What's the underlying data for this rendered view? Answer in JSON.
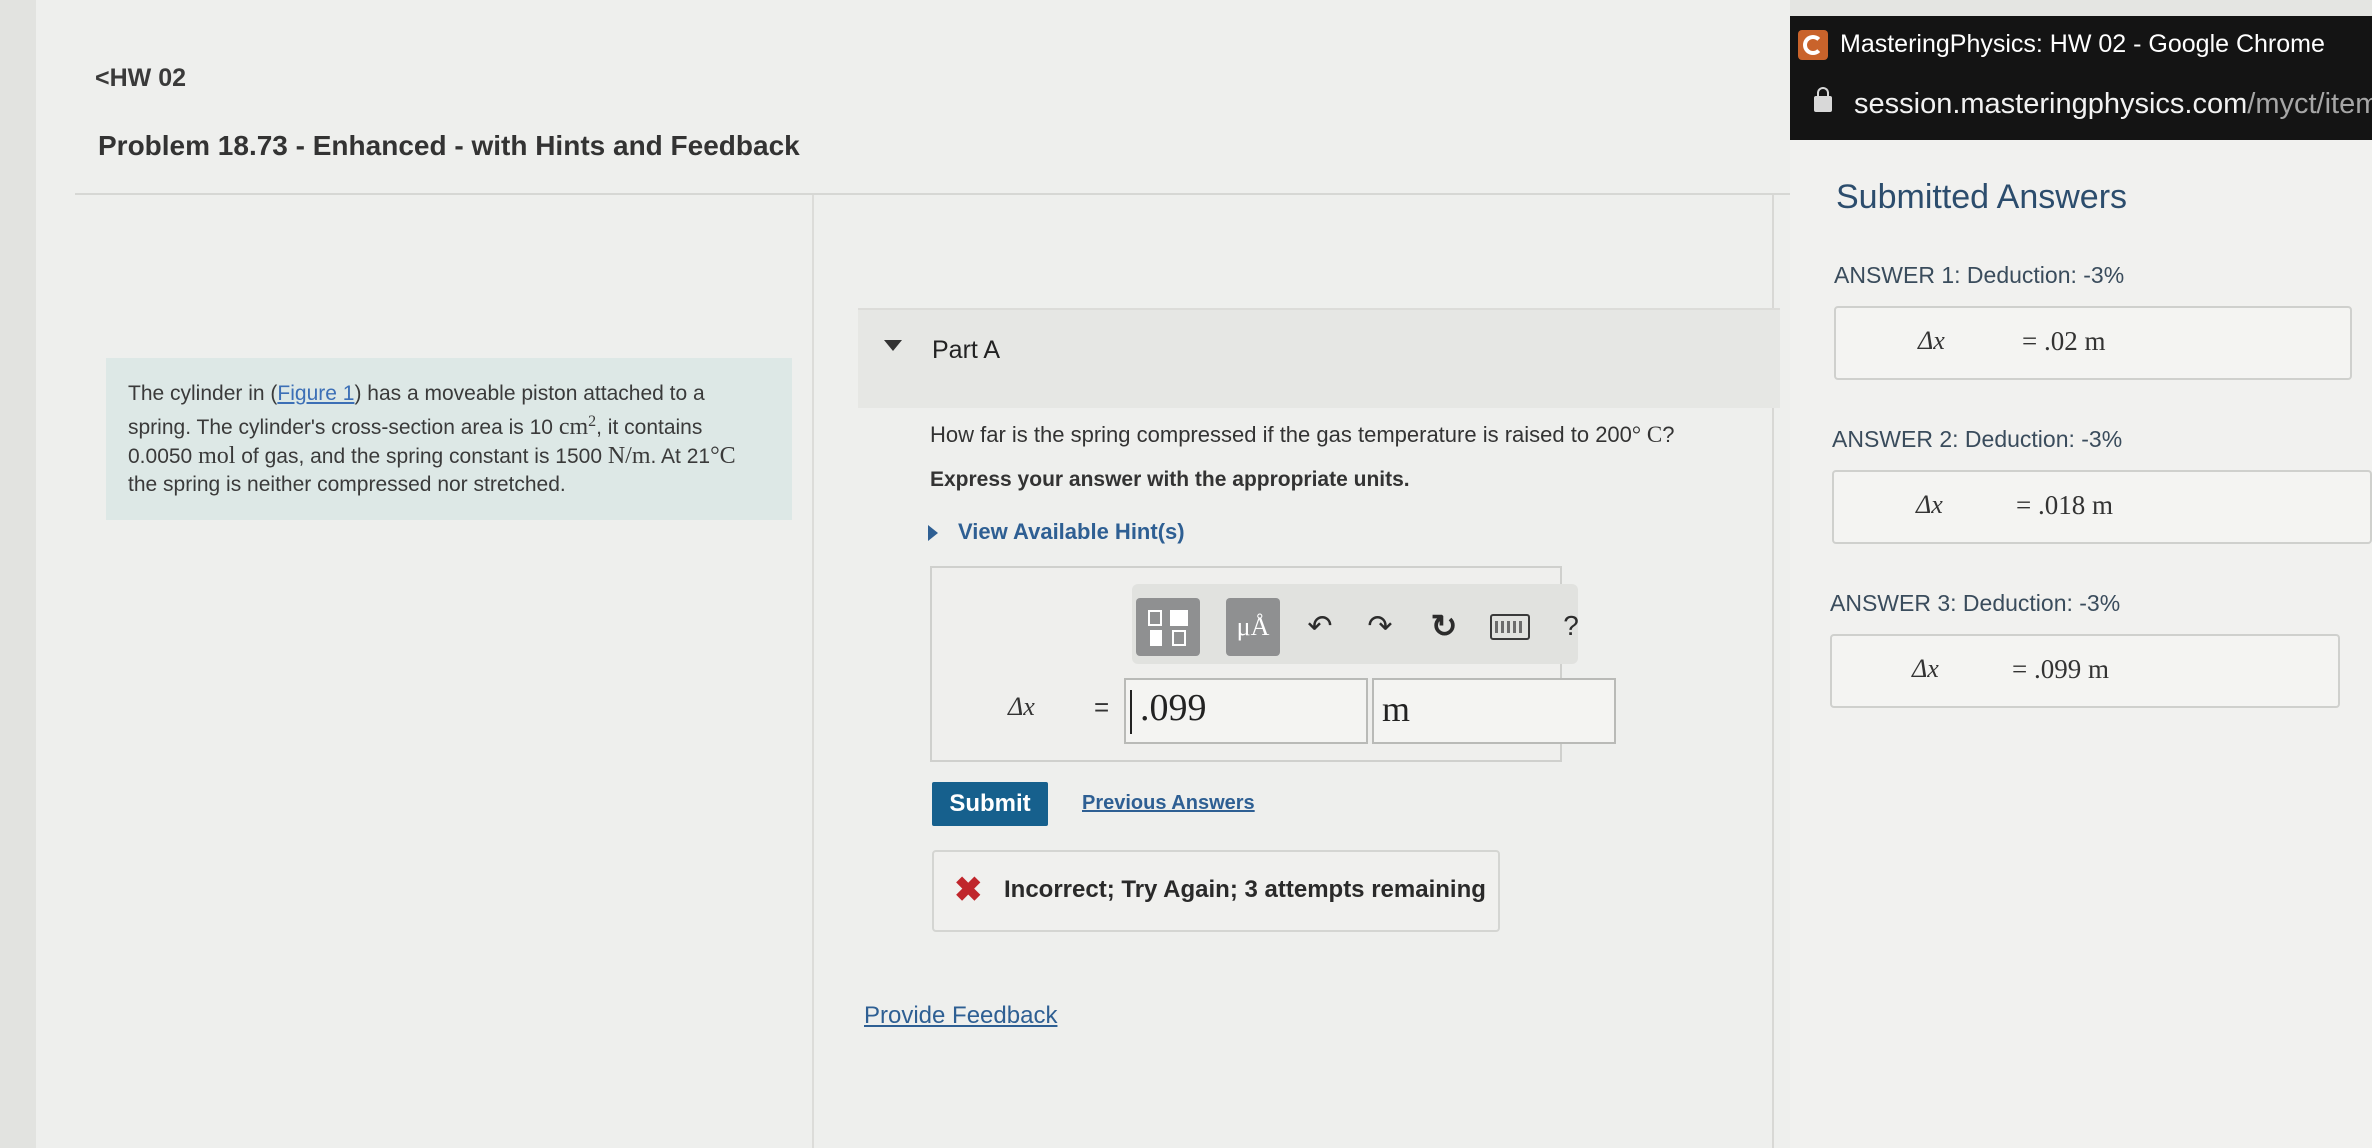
{
  "header": {
    "back_link": "HW 02",
    "problem_title": "Problem 18.73 - Enhanced - with Hints and Feedback"
  },
  "problem": {
    "text_1": "The cylinder in (",
    "figure_link": "Figure 1",
    "text_2": ") has a moveable piston attached to a spring. The cylinder's cross-section area is 10 ",
    "area_unit": "cm",
    "area_exp": "2",
    "text_3": ", it contains 0.0050 ",
    "mol_unit": "mol",
    "text_4": " of gas, and the spring constant is 1500 ",
    "k_unit": "N/m",
    "text_5": ". At 21",
    "temp_unit": "°C",
    "text_6": " the spring is neither compressed nor stretched."
  },
  "part_a": {
    "label": "Part A",
    "question_text": "How far is the spring compressed if the gas temperature is raised to 200",
    "question_unit": "° C",
    "question_end": "?",
    "instruction": "Express your answer with the appropriate units.",
    "hints_link": "View Available Hint(s)"
  },
  "toolbar": {
    "units_label": "μÅ",
    "undo_icon": "↶",
    "redo_icon": "↷",
    "reset_icon": "↻",
    "help_label": "?"
  },
  "answer": {
    "variable": "Δx",
    "equals": "=",
    "value": ".099",
    "unit": "m"
  },
  "actions": {
    "submit_label": "Submit",
    "previous_answers_label": "Previous Answers"
  },
  "feedback": {
    "icon": "✖",
    "message": "Incorrect; Try Again; 3 attempts remaining",
    "status_color": "#c0262c"
  },
  "footer": {
    "provide_feedback": "Provide Feedback"
  },
  "popup": {
    "window_title": "MasteringPhysics: HW 02 - Google Chrome",
    "url_host": "session.masteringphysics.com",
    "url_path": "/myct/itemView",
    "heading": "Submitted Answers",
    "answers": [
      {
        "label": "ANSWER 1: Deduction: -3%",
        "variable": "Δx",
        "value": "= .02 m"
      },
      {
        "label": "ANSWER 2: Deduction: -3%",
        "variable": "Δx",
        "value": "= .018 m"
      },
      {
        "label": "ANSWER 3: Deduction: -3%",
        "variable": "Δx",
        "value": "= .099 m"
      }
    ]
  },
  "colors": {
    "link": "#2e5f93",
    "submit": "#16608d",
    "problem_box": "#dde8e6"
  }
}
